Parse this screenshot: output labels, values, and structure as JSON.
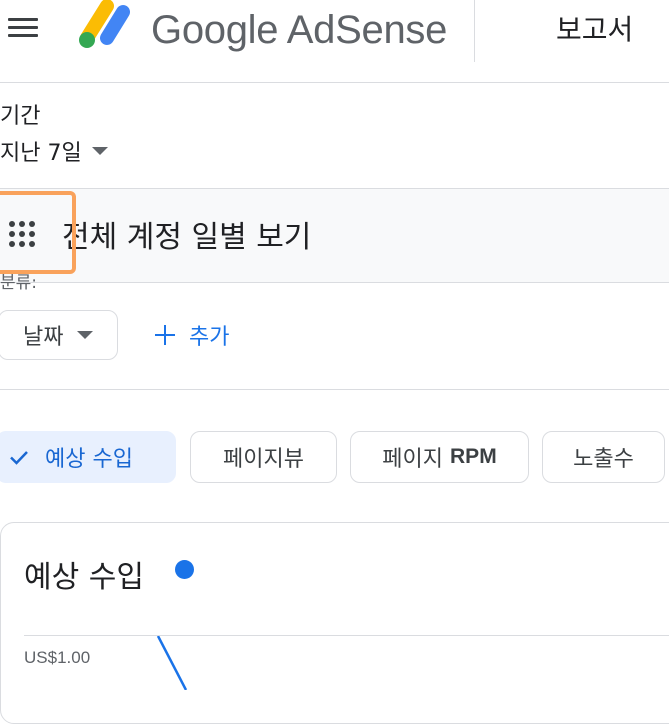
{
  "header": {
    "brand_name": "Google AdSense",
    "page_title": "보고서",
    "icons": {
      "menu": "hamburger-menu-icon",
      "logo": "adsense-logo-icon"
    }
  },
  "filters": {
    "period_label": "기간",
    "period_value": "지난 7일"
  },
  "view_bar": {
    "title": "전체 계정 일별 보기",
    "icon": "apps-grid-icon",
    "highlight_color": "#f9a25b"
  },
  "breakdown": {
    "label": "분류:",
    "chip_label": "날짜",
    "add_label": "추가"
  },
  "metrics": {
    "items": [
      {
        "label": "예상 수입",
        "selected": true
      },
      {
        "label": "페이지뷰",
        "selected": false
      },
      {
        "label_prefix": "페이지 ",
        "label_suffix": "RPM",
        "selected": false
      },
      {
        "label": "노출수",
        "selected": false
      }
    ]
  },
  "chart": {
    "title": "예상 수입",
    "series_color": "#1a73e8",
    "y_tick": "US$1.00"
  },
  "colors": {
    "accent": "#1a73e8",
    "selected_chip_bg": "#e8f0fe",
    "border": "#dadce0"
  },
  "chart_data": {
    "type": "line",
    "series": [
      {
        "values": [
          1.0,
          0.85
        ]
      }
    ],
    "y_ticks": [
      "US$1.00"
    ]
  }
}
